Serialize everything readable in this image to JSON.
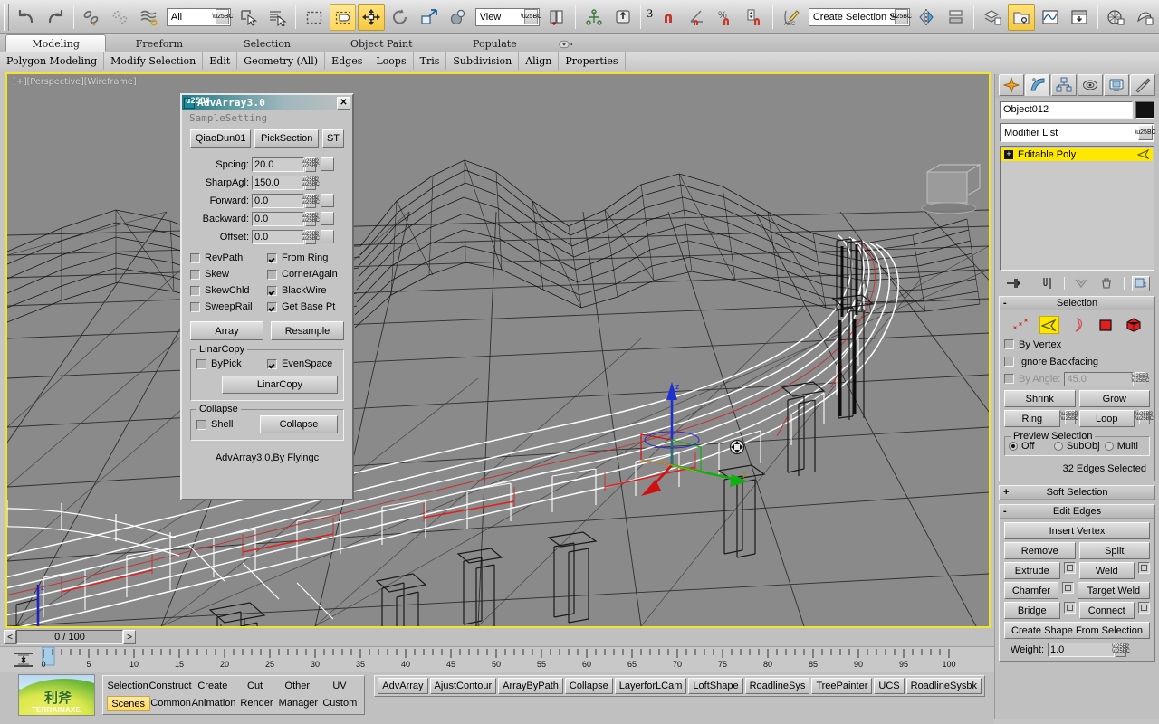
{
  "toolbar": {
    "selection_filter": "All",
    "reference_coord": "View",
    "named_selection_sets": "Create Selection Set",
    "snap_number": "3",
    "icons": [
      "undo-icon",
      "redo-icon",
      "select-link-icon",
      "unlink-icon",
      "bind-space-warp-icon",
      "select-object-icon",
      "select-by-name-icon",
      "rectangular-region-icon",
      "window-crossing-icon",
      "select-and-move-icon",
      "select-and-rotate-icon",
      "select-and-scale-icon",
      "use-pivot-center-icon",
      "select-and-place-icon",
      "mirror-icon",
      "align-icon",
      "layer-manager-icon",
      "graph-editor-icon",
      "render-setup-icon",
      "rendered-frame-window-icon",
      "material-editor-icon",
      "render-production-icon",
      "snaps-toggle-icon",
      "angle-snap-icon",
      "percent-snap-icon",
      "spinner-snap-icon",
      "edit-named-selection-icon"
    ]
  },
  "ribbon": {
    "tabs": [
      "Modeling",
      "Freeform",
      "Selection",
      "Object Paint",
      "Populate"
    ],
    "selected_tab": "Modeling",
    "panels": [
      "Polygon Modeling",
      "Modify Selection",
      "Edit",
      "Geometry (All)",
      "Edges",
      "Loops",
      "Tris",
      "Subdivision",
      "Align",
      "Properties"
    ]
  },
  "viewport": {
    "label": "[+][Perspective][Wireframe]",
    "border_color": "#f2e42a",
    "background": "#8a8a8a",
    "gizmo": {
      "z_axis_color": "#1f2fd0",
      "x_axis_color": "#d01010",
      "y_axis_color": "#10b010"
    }
  },
  "dialog": {
    "title": "AdvArray3.0",
    "close_label": "✕",
    "subtitle": "SampleSetting",
    "top_buttons": [
      "QiaoDun01",
      "PickSection",
      "ST"
    ],
    "spinners": [
      {
        "label": "Spcing:",
        "value": "20.0",
        "extra": true
      },
      {
        "label": "SharpAgl:",
        "value": "150.0",
        "extra": false
      },
      {
        "label": "Forward:",
        "value": "0.0",
        "extra": true
      },
      {
        "label": "Backward:",
        "value": "0.0",
        "extra": true
      },
      {
        "label": "Offset:",
        "value": "0.0",
        "extra": true
      }
    ],
    "checks_left": [
      {
        "label": "RevPath",
        "checked": false
      },
      {
        "label": "Skew",
        "checked": false
      },
      {
        "label": "SkewChld",
        "checked": false
      },
      {
        "label": "SweepRail",
        "checked": false
      }
    ],
    "checks_right": [
      {
        "label": "From Ring",
        "checked": true
      },
      {
        "label": "CornerAgain",
        "checked": false
      },
      {
        "label": "BlackWire",
        "checked": true
      },
      {
        "label": "Get Base Pt",
        "checked": true
      }
    ],
    "action_buttons": [
      "Array",
      "Resample"
    ],
    "linarcopy": {
      "group_label": "LinarCopy",
      "bypick": {
        "label": "ByPick",
        "checked": false
      },
      "evenspace": {
        "label": "EvenSpace",
        "checked": true
      },
      "button": "LinarCopy"
    },
    "collapse": {
      "group_label": "Collapse",
      "shell": {
        "label": "Shell",
        "checked": false
      },
      "button": "Collapse"
    },
    "credit": "AdvArray3.0,By Flyingc"
  },
  "command_panel": {
    "tabs": [
      "create-tab-icon",
      "modify-tab-icon",
      "hierarchy-tab-icon",
      "motion-tab-icon",
      "display-tab-icon",
      "utilities-tab-icon"
    ],
    "selected_tab_index": 1,
    "object_name": "Object012",
    "object_color": "#121212",
    "modifier_list_label": "Modifier List",
    "stack": [
      {
        "label": "Editable Poly",
        "highlighted": true
      }
    ],
    "stack_tools": [
      "pin-stack-icon",
      "show-end-result-icon",
      "make-unique-icon",
      "remove-modifier-icon",
      "configure-sets-icon"
    ],
    "selection_rollout": {
      "title": "Selection",
      "sign": "-",
      "subobject_icons": [
        "vertex-icon",
        "edge-icon",
        "border-icon",
        "polygon-icon",
        "element-icon"
      ],
      "selected_subobject_index": 1,
      "by_vertex": {
        "label": "By Vertex",
        "checked": false
      },
      "ignore_backfacing": {
        "label": "Ignore Backfacing",
        "checked": false
      },
      "by_angle": {
        "label": "By Angle:",
        "checked": false,
        "value": "45.0",
        "disabled": true
      },
      "shrink": "Shrink",
      "grow": "Grow",
      "ring": "Ring",
      "loop": "Loop",
      "preview_selection": {
        "group_label": "Preview Selection",
        "options": [
          "Off",
          "SubObj",
          "Multi"
        ],
        "selected": "Off"
      },
      "status": "32 Edges Selected"
    },
    "soft_selection_rollout": {
      "title": "Soft Selection",
      "sign": "+"
    },
    "edit_edges_rollout": {
      "title": "Edit Edges",
      "sign": "-",
      "insert_vertex": "Insert Vertex",
      "remove": "Remove",
      "split": "Split",
      "extrude": "Extrude",
      "weld": "Weld",
      "chamfer": "Chamfer",
      "target_weld": "Target Weld",
      "bridge": "Bridge",
      "connect": "Connect",
      "create_shape": "Create Shape From Selection",
      "weight_label": "Weight:",
      "weight_value": "1.0"
    }
  },
  "bottom": {
    "frame_prev": "<",
    "frame_next": ">",
    "frame_indicator": "0 / 100",
    "timeline_ticks": [
      0,
      5,
      10,
      15,
      20,
      25,
      30,
      35,
      40,
      45,
      50,
      55,
      60,
      65,
      70,
      75,
      80,
      85,
      90,
      95,
      100
    ],
    "timeline_start": 0,
    "timeline_end": 100,
    "logo": {
      "cn": "利斧",
      "en": "TERRAINAXE"
    },
    "tab_panel": {
      "row1": [
        "Selection",
        "Construct",
        "Create",
        "Cut",
        "Other",
        "UV"
      ],
      "row2": [
        "Scenes",
        "Common",
        "Animation",
        "Render",
        "Manager",
        "Custom"
      ],
      "selected": "Scenes"
    },
    "script_buttons": [
      "AdvArray",
      "AjustContour",
      "ArrayByPath",
      "Collapse",
      "LayerforLCam",
      "LoftShape",
      "RoadlineSys",
      "TreePainter",
      "UCS",
      "RoadlineSysbk"
    ]
  }
}
